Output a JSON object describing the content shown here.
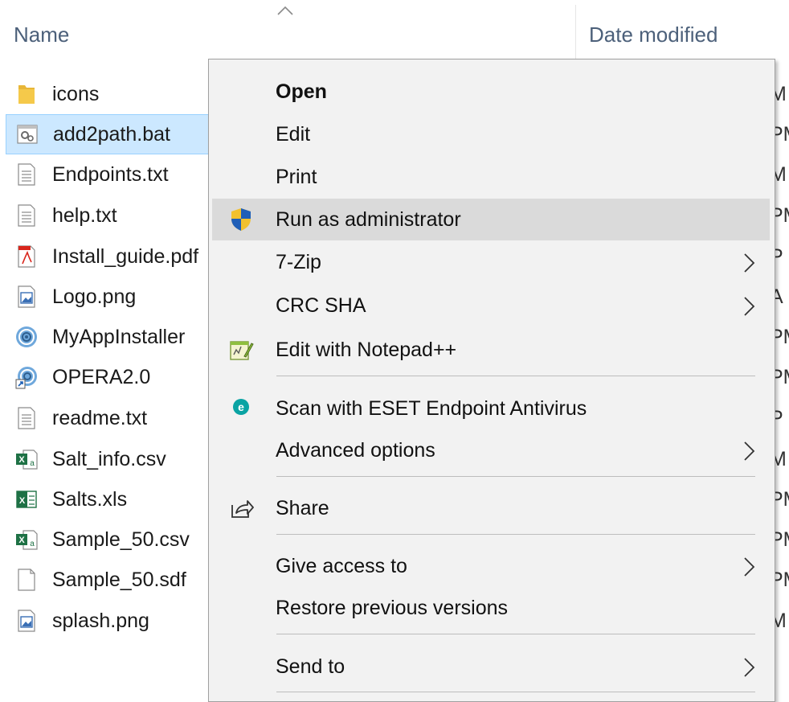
{
  "header": {
    "name_column": "Name",
    "date_column": "Date modified"
  },
  "files": [
    {
      "name": "icons",
      "icon": "folder-icon",
      "date_fragment": "M"
    },
    {
      "name": "add2path.bat",
      "icon": "batch-file-icon",
      "date_fragment": "PM",
      "selected": true
    },
    {
      "name": "Endpoints.txt",
      "icon": "text-file-icon",
      "date_fragment": "M"
    },
    {
      "name": "help.txt",
      "icon": "text-file-icon",
      "date_fragment": "PM"
    },
    {
      "name": "Install_guide.pdf",
      "icon": "pdf-file-icon",
      "date_fragment": "P"
    },
    {
      "name": "Logo.png",
      "icon": "image-file-icon",
      "date_fragment": "A"
    },
    {
      "name": "MyAppInstaller",
      "icon": "installer-icon",
      "date_fragment": "PM"
    },
    {
      "name": "OPERA2.0",
      "icon": "shortcut-icon",
      "date_fragment": "PM"
    },
    {
      "name": "readme.txt",
      "icon": "text-file-icon",
      "date_fragment": "P"
    },
    {
      "name": "Salt_info.csv",
      "icon": "csv-file-icon",
      "date_fragment": "M"
    },
    {
      "name": "Salts.xls",
      "icon": "excel-file-icon",
      "date_fragment": "PM"
    },
    {
      "name": "Sample_50.csv",
      "icon": "csv-file-icon",
      "date_fragment": "PM"
    },
    {
      "name": "Sample_50.sdf",
      "icon": "blank-file-icon",
      "date_fragment": "PM"
    },
    {
      "name": "splash.png",
      "icon": "image-file-icon",
      "date_fragment": "M"
    }
  ],
  "context_menu": {
    "items": [
      {
        "label": "Open",
        "bold": true
      },
      {
        "label": "Edit"
      },
      {
        "label": "Print"
      },
      {
        "label": "Run as administrator",
        "icon": "uac-shield-icon",
        "hovered": true
      },
      {
        "label": "7-Zip",
        "submenu": true
      },
      {
        "label": "CRC SHA",
        "submenu": true
      },
      {
        "label": "Edit with Notepad++",
        "icon": "notepad-plus-plus-icon"
      },
      {
        "label": "Scan with ESET Endpoint Antivirus",
        "icon": "eset-icon"
      },
      {
        "label": "Advanced options",
        "submenu": true
      },
      {
        "label": "Share",
        "icon": "share-icon"
      },
      {
        "label": "Give access to",
        "submenu": true
      },
      {
        "label": "Restore previous versions"
      },
      {
        "label": "Send to",
        "submenu": true
      }
    ]
  },
  "colors": {
    "selection_bg": "#cce8ff",
    "menu_bg": "#f2f2f2",
    "menu_hover": "#dadada",
    "header_text": "#4c607a"
  }
}
